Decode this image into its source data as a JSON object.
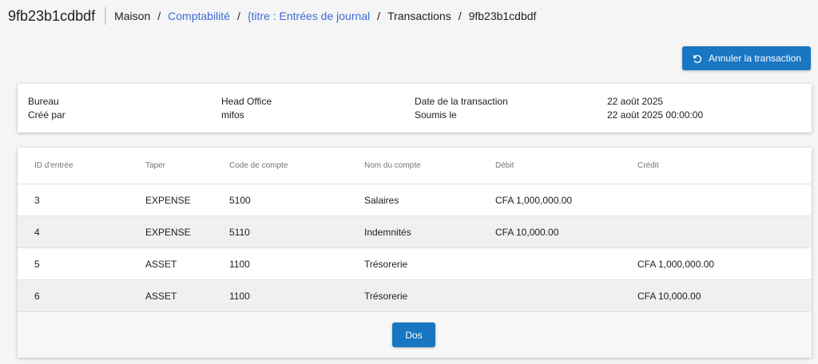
{
  "header": {
    "title": "9fb23b1cdbdf",
    "breadcrumb": [
      {
        "label": "Maison",
        "link": false
      },
      {
        "label": "Comptabilité",
        "link": true
      },
      {
        "label": "{titre : Entrées de journal",
        "link": true
      },
      {
        "label": "Transactions",
        "link": false
      },
      {
        "label": "9fb23b1cdbdf",
        "link": false
      }
    ],
    "separator": "/"
  },
  "actions": {
    "undo_label": "Annuler la transaction",
    "undo_icon": "undo-icon",
    "back_label": "Dos"
  },
  "info": {
    "office_label": "Bureau",
    "office_value": "Head Office",
    "created_by_label": "Créé par",
    "created_by_value": "mifos",
    "transaction_date_label": "Date de la transaction",
    "transaction_date_value": "22 août 2025",
    "submitted_label": "Soumis le",
    "submitted_value": "22 août 2025 00:00:00"
  },
  "table": {
    "columns": [
      "ID d'entrée",
      "Taper",
      "Code de compte",
      "Nom du compte",
      "Débit",
      "Crédit"
    ],
    "rows": [
      {
        "id": "3",
        "type": "EXPENSE",
        "code": "5100",
        "name": "Salaires",
        "debit": "CFA 1,000,000.00",
        "credit": ""
      },
      {
        "id": "4",
        "type": "EXPENSE",
        "code": "5110",
        "name": "Indemnités",
        "debit": "CFA 10,000.00",
        "credit": ""
      },
      {
        "id": "5",
        "type": "ASSET",
        "code": "1100",
        "name": "Trésorerie",
        "debit": "",
        "credit": "CFA 1,000,000.00"
      },
      {
        "id": "6",
        "type": "ASSET",
        "code": "1100",
        "name": "Trésorerie",
        "debit": "",
        "credit": "CFA 10,000.00"
      }
    ]
  },
  "colors": {
    "primary": "#1976c2",
    "link": "#3f6ad8",
    "background": "#f5f5f5"
  }
}
